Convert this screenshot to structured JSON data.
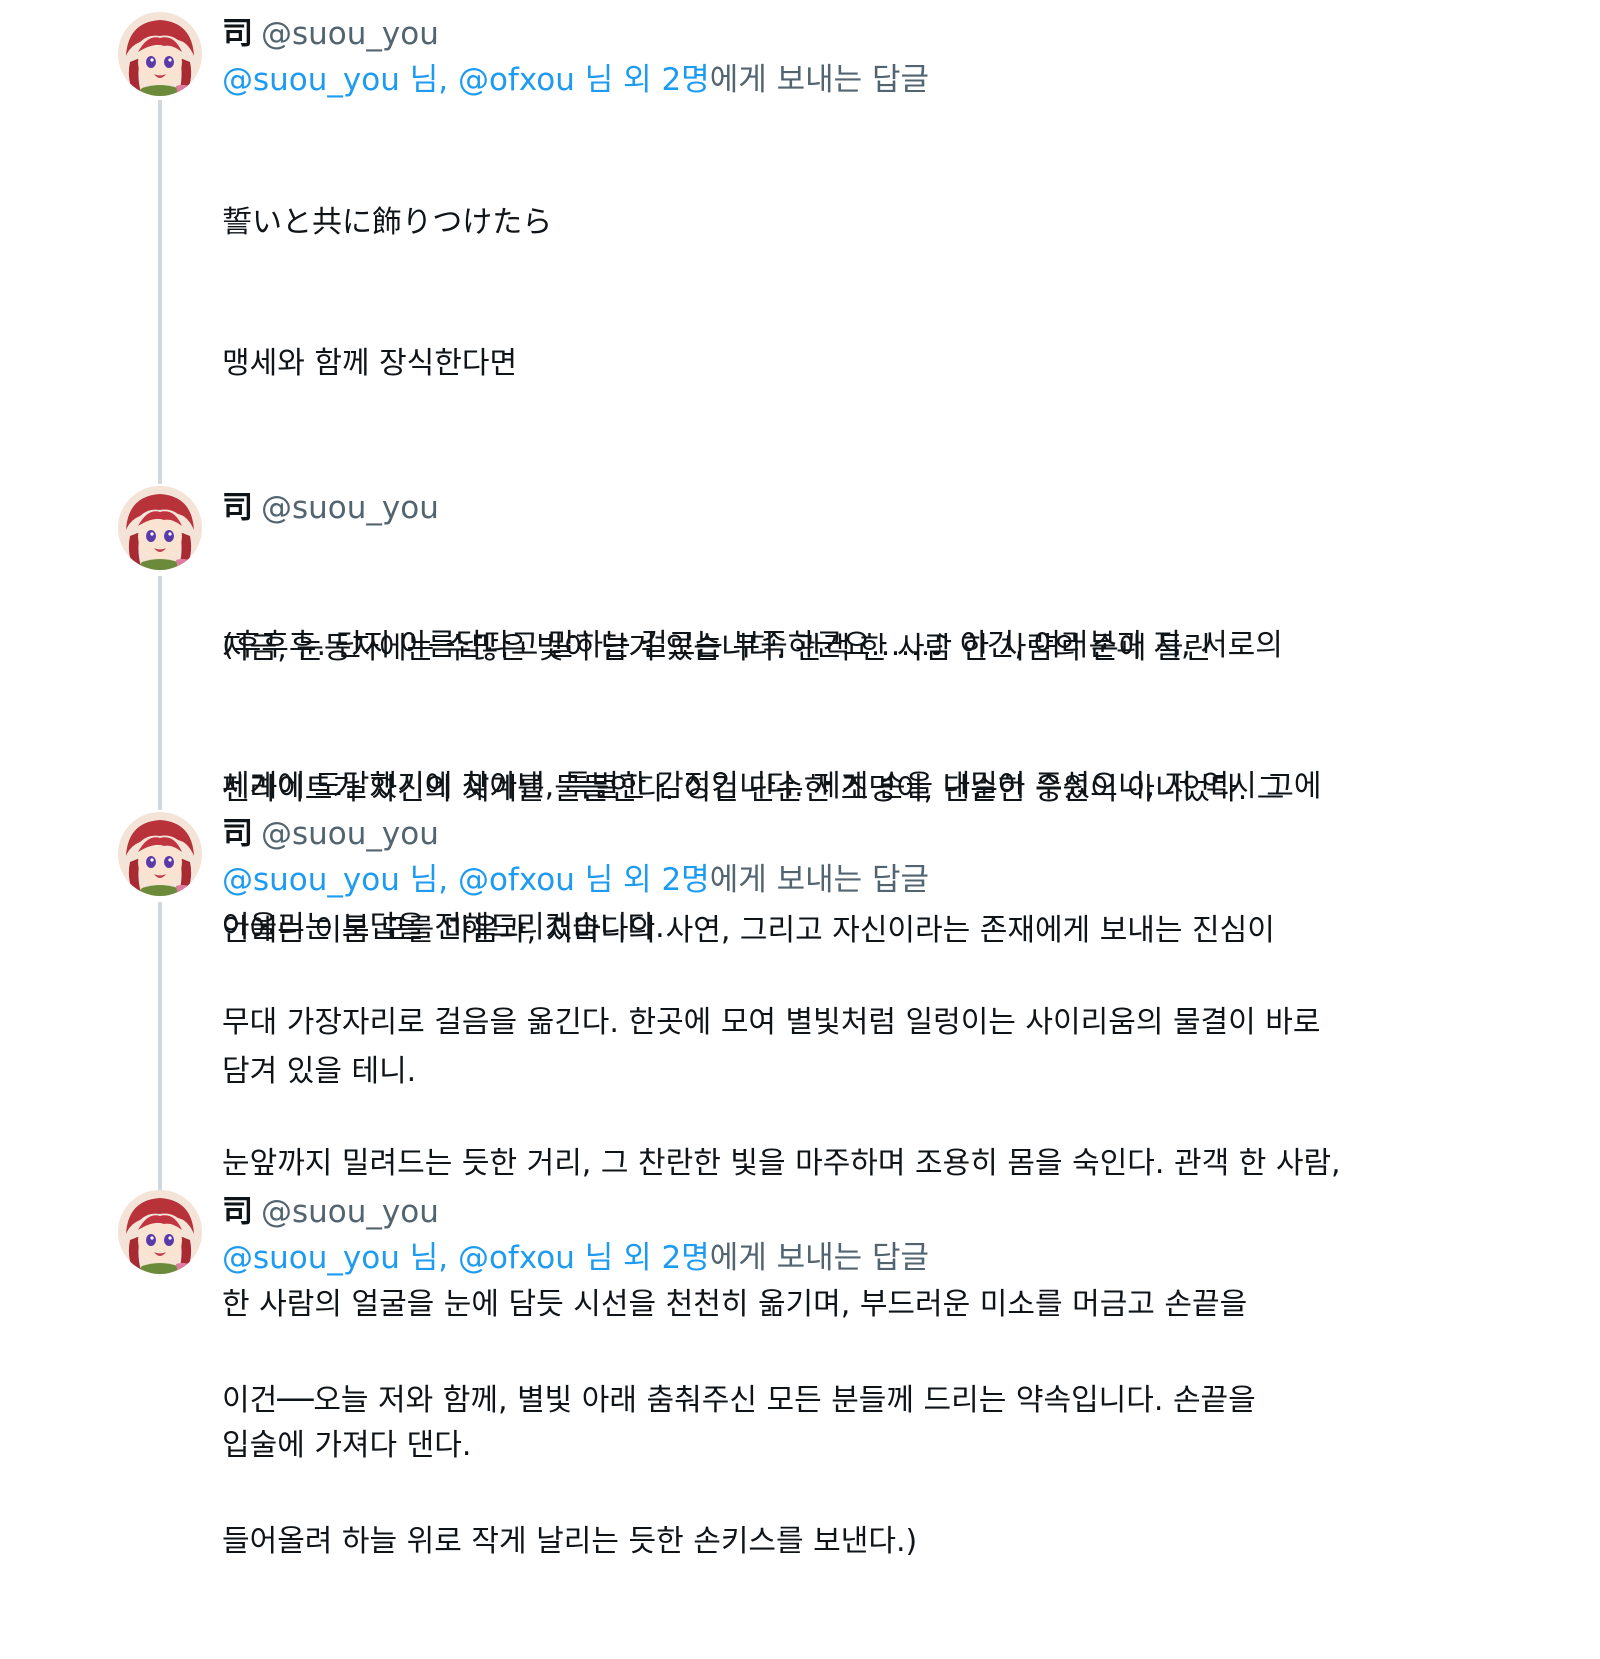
{
  "tweets": [
    {
      "display_name": "司",
      "handle": "@suou_you",
      "reply": {
        "mention1": "@suou_you 님, ",
        "mention2": "@ofxou 님 외 2명",
        "suffix": "에게 보내는 답글"
      },
      "lines": [
        "誓いと共に飾りつけたら",
        "맹세와 함께 장식한다면",
        "",
        "(후후후. 단지 아름답다고 말하는 걸로는 부족하군요……♪ 이건, 여러분과 저, 서로의",
        "세계에 도달했기에 찾아낸, 특별한 감정입니다. 제게 손을 내밀어 주셨으니, 저 역시 그에",
        "어울리는 보답을 전해드리겠습니다."
      ]
    },
    {
      "display_name": "司",
      "handle": "@suou_you",
      "lines": [
        "지금, 눈동자에는 수많은 빛이 담겨 있습니다. 관객 한 사람 한 사람의 손에 들린",
        "펜라이트가 자신의 세계를 물들인다. 이건 단순한 조명이, 단순한 응원이 아니었다. 그",
        "안에는 이름 모를 마음과, 저마다의 사연, 그리고 자신이라는 존재에게 보내는 진심이",
        "담겨 있을 테니."
      ]
    },
    {
      "display_name": "司",
      "handle": "@suou_you",
      "reply": {
        "mention1": "@suou_you 님, ",
        "mention2": "@ofxou 님 외 2명",
        "suffix": "에게 보내는 답글"
      },
      "lines": [
        "무대 가장자리로 걸음을 옮긴다. 한곳에 모여 별빛처럼 일렁이는 사이리움의 물결이 바로",
        "눈앞까지 밀려드는 듯한 거리, 그 찬란한 빛을 마주하며 조용히 몸을 숙인다. 관객 한 사람,",
        "한 사람의 얼굴을 눈에 담듯 시선을 천천히 옮기며, 부드러운 미소를 머금고 손끝을",
        "입술에 가져다 댄다."
      ]
    },
    {
      "display_name": "司",
      "handle": "@suou_you",
      "reply": {
        "mention1": "@suou_you 님, ",
        "mention2": "@ofxou 님 외 2명",
        "suffix": "에게 보내는 답글"
      },
      "lines": [
        "이건──오늘 저와 함께, 별빛 아래 춤춰주신 모든 분들께 드리는 약속입니다. 손끝을",
        "들어올려 하늘 위로 작게 날리는 듯한 손키스를 보낸다.)"
      ]
    }
  ]
}
